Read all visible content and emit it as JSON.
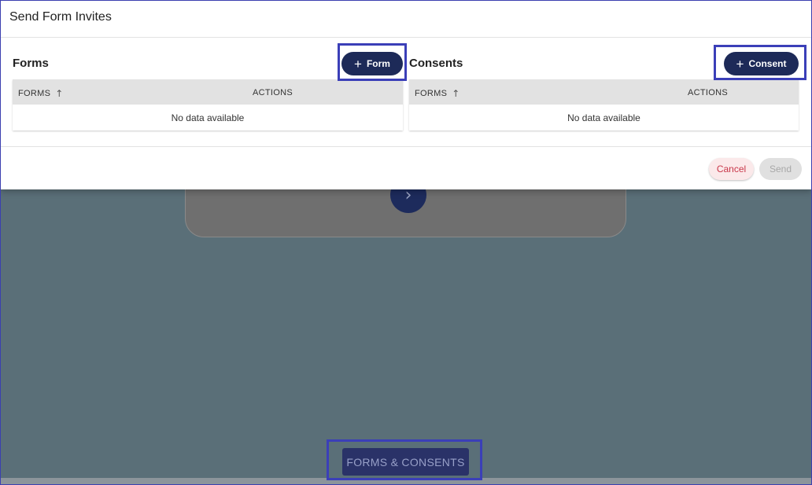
{
  "dialog": {
    "title": "Send Form Invites",
    "forms": {
      "title": "Forms",
      "add_label": "Form",
      "columns": [
        "FORMS",
        "ACTIONS"
      ],
      "empty_text": "No data available"
    },
    "consents": {
      "title": "Consents",
      "add_label": "Consent",
      "columns": [
        "FORMS",
        "ACTIONS"
      ],
      "empty_text": "No data available"
    },
    "footer": {
      "cancel_label": "Cancel",
      "send_label": "Send"
    }
  },
  "background": {
    "next_icon": "chevron-right-icon",
    "bottom_button_label": "FORMS & CONSENTS"
  },
  "icons": {
    "add": "plus-icon",
    "sort": "arrow-up-icon"
  },
  "colors": {
    "primary": "#1d2a58",
    "cancel_text": "#c9374a",
    "highlight": "#3b3fb8",
    "table_header": "#e2e2e2"
  }
}
